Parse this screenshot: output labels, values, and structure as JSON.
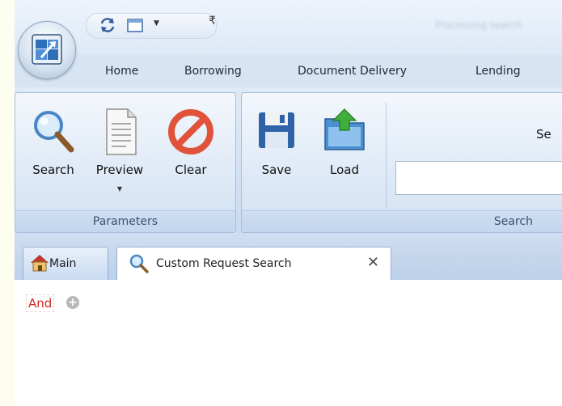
{
  "title_bar": {
    "faint_title": "Processing search"
  },
  "ribbon_tabs": [
    {
      "label": "Home"
    },
    {
      "label": "Borrowing"
    },
    {
      "label": "Document Delivery"
    },
    {
      "label": "Lending"
    }
  ],
  "ribbon": {
    "parameters_group": {
      "label": "Parameters",
      "buttons": [
        {
          "label": "Search",
          "icon": "magnifier-icon"
        },
        {
          "label": "Preview",
          "icon": "document-preview-icon"
        },
        {
          "label": "Clear",
          "icon": "clear-icon"
        }
      ]
    },
    "search_group": {
      "label": "Search",
      "buttons": [
        {
          "label": "Save",
          "icon": "floppy-disk-icon"
        },
        {
          "label": "Load",
          "icon": "folder-load-icon"
        }
      ],
      "text_label": "Se",
      "input_value": ""
    }
  },
  "doc_tabs": [
    {
      "label": "Main",
      "icon": "home-icon"
    },
    {
      "label": "Custom Request Search",
      "icon": "magnifier-icon",
      "closable": true
    }
  ],
  "content": {
    "operator": "And",
    "add_icon": "plus-circle-icon"
  },
  "colors": {
    "operator_red": "#d12a2a",
    "ribbon_blue": "#c9dbf0"
  }
}
